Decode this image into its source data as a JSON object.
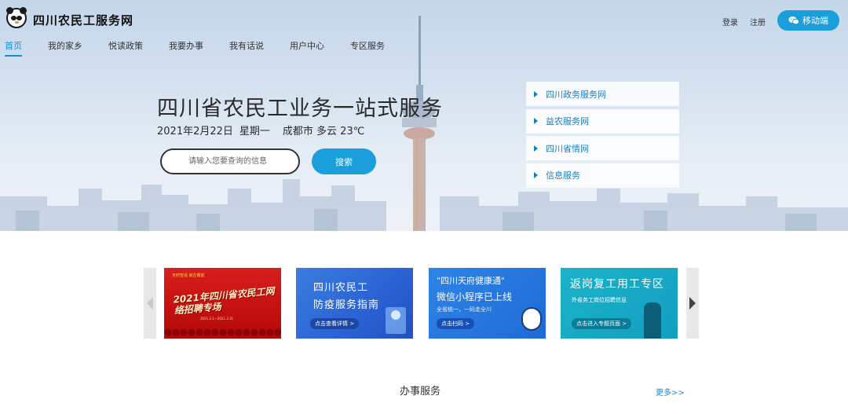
{
  "header": {
    "site_title": "四川农民工服务网",
    "login": "登录",
    "register": "注册",
    "mobile_label": "移动端"
  },
  "nav": {
    "items": [
      "首页",
      "我的家乡",
      "悦读政策",
      "我要办事",
      "我有话说",
      "用户中心",
      "专区服务"
    ],
    "active_index": 0
  },
  "hero": {
    "title": "四川省农民工业务一站式服务",
    "date": "2021年2月22日",
    "weekday": "星期一",
    "weather": "成都市 多云 23℃"
  },
  "search": {
    "placeholder": "请输入您要查询的信息",
    "button_label": "搜索"
  },
  "quick_links": [
    "四川政务服务网",
    "益农服务网",
    "四川省情网",
    "信息服务"
  ],
  "banners": [
    {
      "tag": "天府智造 就在眼前",
      "title": "2021年四川省农民工网络招聘专场",
      "footer": "2021.2.1—2021.3.31"
    },
    {
      "title_line1": "四川农民工",
      "title_line2": "防疫服务指南",
      "cta": "点击查看详情 >"
    },
    {
      "title_line1": "\"四川天府健康通\"",
      "title_line2": "微信小程序已上线",
      "subtitle": "全省统一，一码走全川",
      "cta": "点击扫码 >"
    },
    {
      "title": "返岗复工用工专区",
      "subtitle": "外省务工岗位招聘信息",
      "cta": "点击进入专题页面 >"
    }
  ],
  "section": {
    "title": "办事服务",
    "more": "更多>>"
  },
  "colors": {
    "accent": "#1a9fdc",
    "nav_active": "#1a8cd8",
    "link": "#1a7fbd"
  }
}
